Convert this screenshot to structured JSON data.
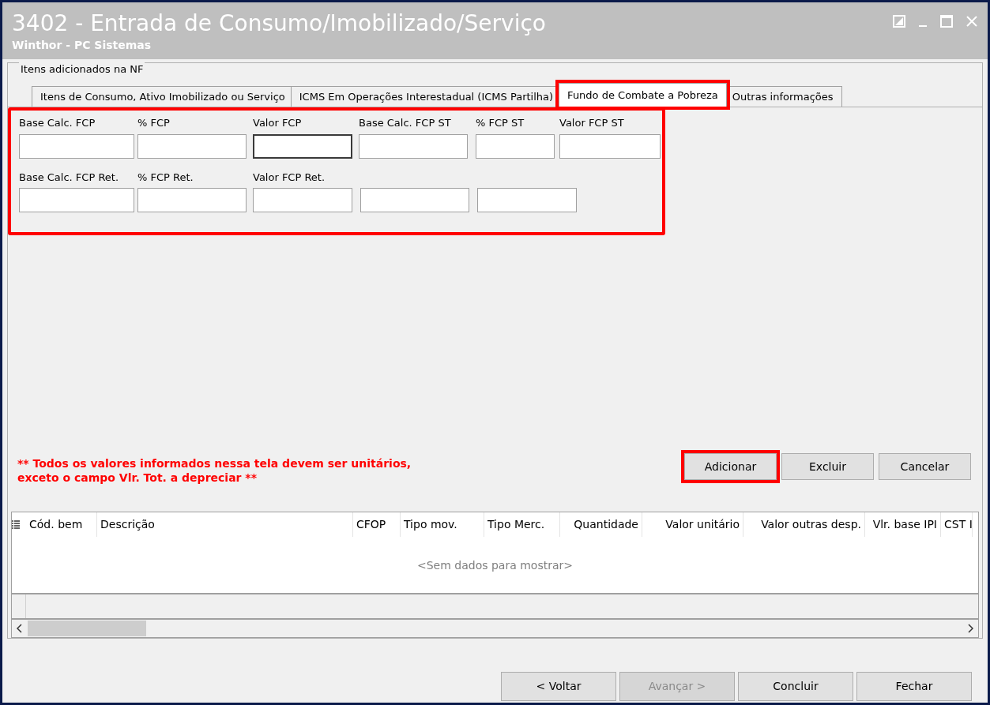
{
  "window": {
    "title": "3402 - Entrada de Consumo/Imobilizado/Serviço",
    "subtitle": "Winthor - PC Sistemas"
  },
  "group": {
    "title": "Itens adicionados na NF"
  },
  "tabs": [
    {
      "label": "Itens de Consumo,  Ativo Imobilizado ou Serviço",
      "selected": false,
      "highlighted": false
    },
    {
      "label": "ICMS Em Operações Interestadual (ICMS Partilha)",
      "selected": false,
      "highlighted": false
    },
    {
      "label": "Fundo de Combate a Pobreza",
      "selected": true,
      "highlighted": true
    },
    {
      "label": "Outras informações",
      "selected": false,
      "highlighted": false
    }
  ],
  "fields_panel": {
    "highlighted": true,
    "rows": [
      [
        {
          "label": "Base Calc. FCP",
          "focused": false
        },
        {
          "label": "% FCP",
          "focused": false
        },
        {
          "label": "Valor FCP",
          "focused": true
        },
        {
          "label": "Base Calc. FCP ST",
          "focused": false
        },
        {
          "label": "% FCP ST",
          "focused": false
        },
        {
          "label": "Valor FCP ST",
          "focused": false
        }
      ],
      [
        {
          "label": "Base Calc. FCP Ret.",
          "focused": false
        },
        {
          "label": "% FCP Ret.",
          "focused": false
        },
        {
          "label": "Valor FCP Ret.",
          "focused": false
        },
        {
          "focused": false
        },
        {
          "focused": false
        }
      ]
    ]
  },
  "note": "** Todos os valores informados nessa tela devem ser unitários,\nexceto o campo Vlr. Tot. a depreciar **",
  "item_buttons": [
    {
      "label": "Adicionar",
      "highlighted": true
    },
    {
      "label": "Excluir",
      "highlighted": false
    },
    {
      "label": "Cancelar",
      "highlighted": false
    }
  ],
  "table": {
    "columns": [
      "Cód. bem",
      "Descrição",
      "CFOP",
      "Tipo mov.",
      "Tipo Merc.",
      "Quantidade",
      "Valor unitário",
      "Valor outras desp.",
      "Vlr. base IPI",
      "CST I"
    ],
    "empty_text": "<Sem dados para mostrar>"
  },
  "footer_buttons": [
    {
      "label": "< Voltar",
      "disabled": false
    },
    {
      "label": "Avançar >",
      "disabled": true
    },
    {
      "label": "Concluir",
      "disabled": false
    },
    {
      "label": "Fechar",
      "disabled": false
    }
  ]
}
